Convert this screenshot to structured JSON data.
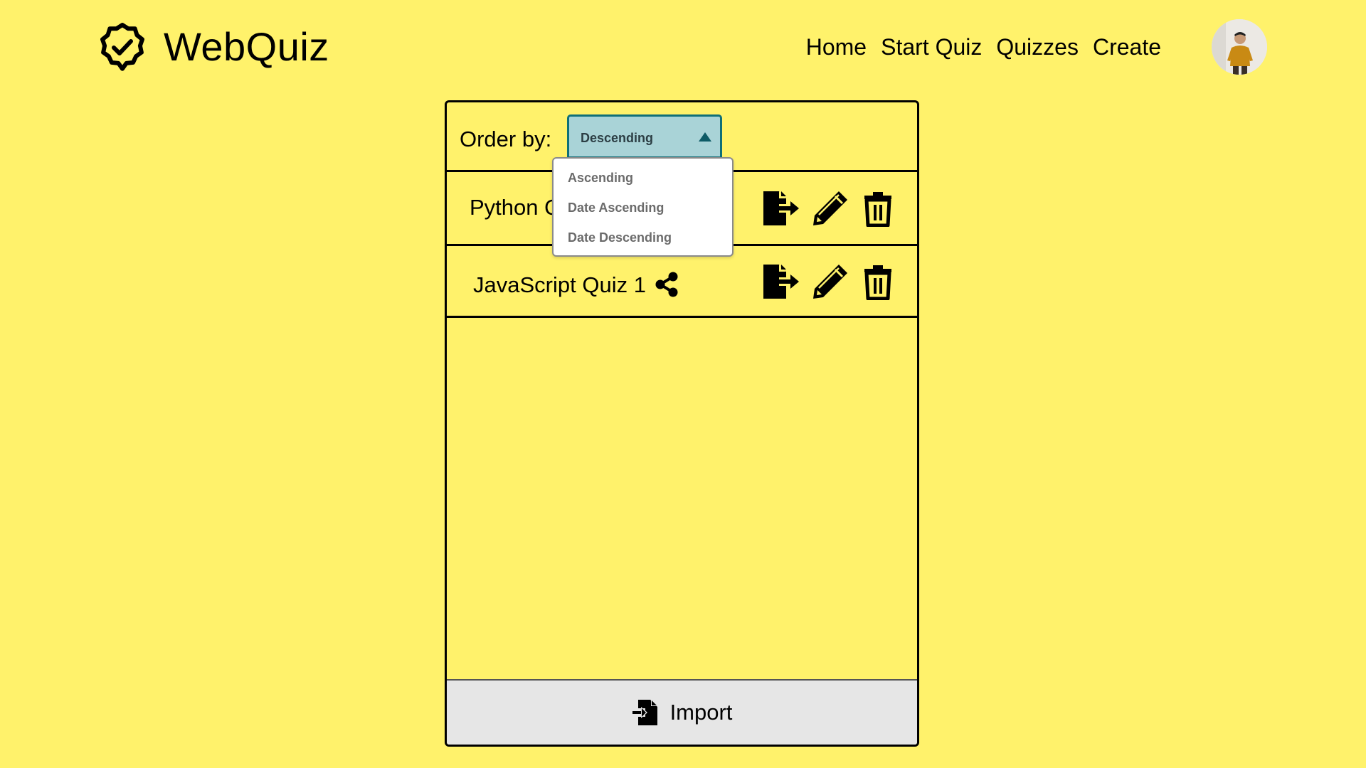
{
  "header": {
    "brand": "WebQuiz",
    "nav": [
      "Home",
      "Start Quiz",
      "Quizzes",
      "Create"
    ]
  },
  "order": {
    "label": "Order by:",
    "selected": "Descending",
    "options": [
      "Ascending",
      "Date Ascending",
      "Date Descending"
    ]
  },
  "quizzes": [
    {
      "title": "Python Quiz"
    },
    {
      "title": "JavaScript Quiz 1"
    }
  ],
  "import": {
    "label": "Import"
  },
  "colors": {
    "background": "#fff26b",
    "select_bg": "#a9d3d7",
    "select_border": "#0f6f78",
    "import_bg": "#e6e6e6"
  },
  "icons": {
    "logo": "badge-check-icon",
    "share": "share-icon",
    "export": "export-file-icon",
    "edit": "pencil-icon",
    "delete": "trash-icon",
    "import": "import-file-icon"
  }
}
